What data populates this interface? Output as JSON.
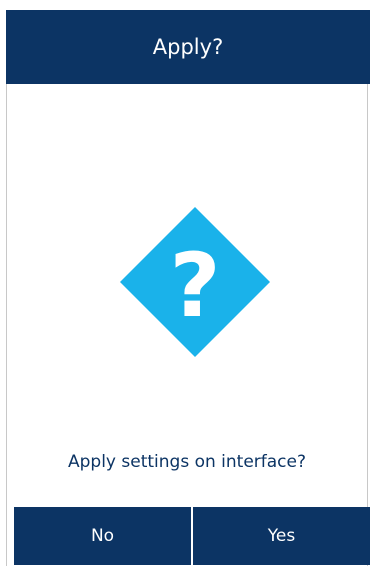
{
  "dialog": {
    "title": "Apply?",
    "icon": "question-icon",
    "message": "Apply settings on interface?",
    "buttons": {
      "no_label": "No",
      "yes_label": "Yes"
    }
  },
  "colors": {
    "header_bg": "#0c3464",
    "button_bg": "#0c3464",
    "icon_fill": "#1ab2ea",
    "message_text": "#0c3464"
  }
}
